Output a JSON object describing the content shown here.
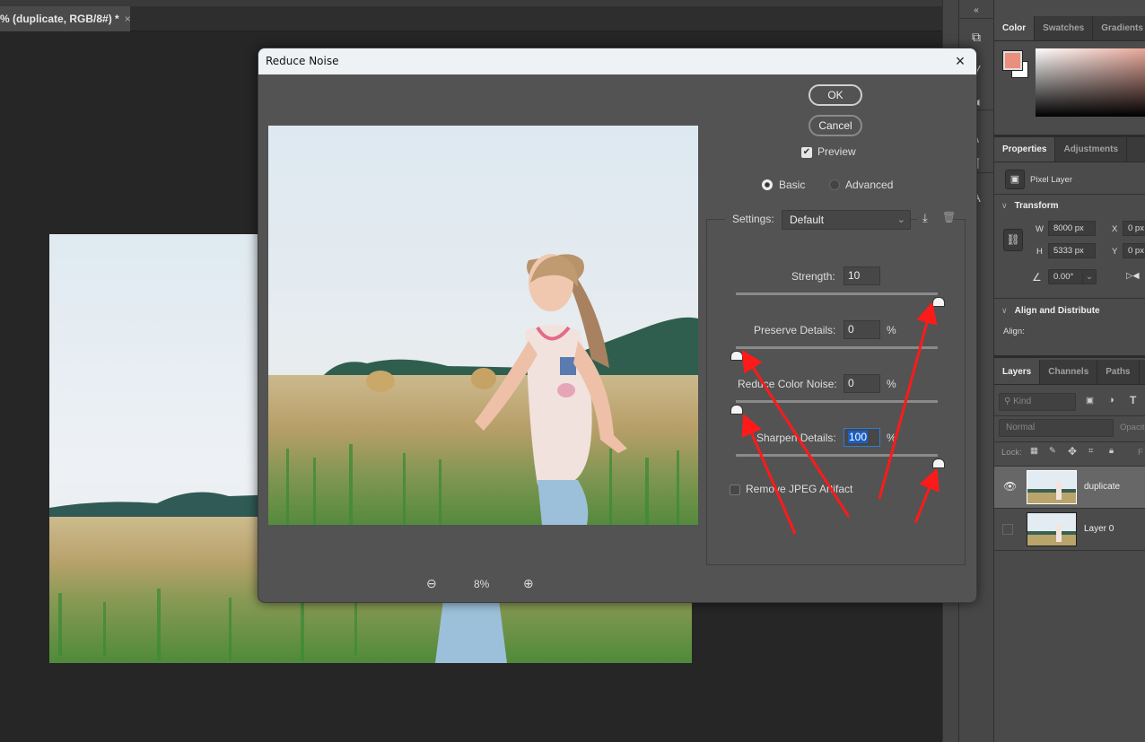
{
  "document_tab": {
    "title": "% (duplicate, RGB/8#) *",
    "close": "×"
  },
  "toolbar_strip": {
    "collapse": "«",
    "icons": [
      "history-icon",
      "brush-preset-icon",
      "tool-preset-icon",
      "clone-source-icon",
      "paragraph-icon",
      "character-icon"
    ]
  },
  "color_panel": {
    "tabs": [
      "Color",
      "Swatches",
      "Gradients"
    ],
    "foreground": "#e98f7d",
    "background": "#ffffff"
  },
  "properties_panel": {
    "tabs": [
      "Properties",
      "Adjustments"
    ],
    "layer_type": "Pixel Layer",
    "transform": {
      "title": "Transform",
      "w_label": "W",
      "w": "8000 px",
      "h_label": "H",
      "h": "5333 px",
      "x_label": "X",
      "x": "0 px",
      "y_label": "Y",
      "y": "0 px",
      "angle": "0.00°"
    },
    "align": {
      "title": "Align and Distribute",
      "label": "Align:"
    }
  },
  "layers_panel": {
    "tabs": [
      "Layers",
      "Channels",
      "Paths"
    ],
    "filter_placeholder": "Kind",
    "blend_mode": "Normal",
    "opacity_label": "Opacit",
    "lock_label": "Lock:",
    "fill_label": "F",
    "layers": [
      {
        "name": "duplicate",
        "visible": true,
        "selected": true
      },
      {
        "name": "Layer 0",
        "visible": false,
        "selected": false
      }
    ]
  },
  "dialog": {
    "title": "Reduce Noise",
    "close": "×",
    "ok": "OK",
    "cancel": "Cancel",
    "preview_label": "Preview",
    "preview_checked": true,
    "mode_basic": "Basic",
    "mode_advanced": "Advanced",
    "mode_selected": "Basic",
    "settings_label": "Settings:",
    "settings_value": "Default",
    "strength_label": "Strength:",
    "strength": "10",
    "strength_fraction": 1.0,
    "preserve_label": "Preserve Details:",
    "preserve": "0",
    "preserve_fraction": 0.0,
    "color_noise_label": "Reduce Color Noise:",
    "color_noise": "0",
    "color_noise_fraction": 0.0,
    "sharpen_label": "Sharpen Details:",
    "sharpen": "100",
    "sharpen_fraction": 1.0,
    "percent": "%",
    "jpeg_label": "Remove JPEG Artifact",
    "jpeg_checked": false,
    "zoom_level": "8%"
  },
  "annotation_color": "#ff1a1a"
}
